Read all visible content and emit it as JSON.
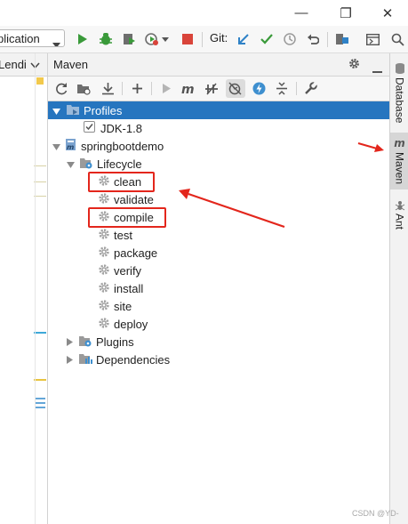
{
  "window": {
    "minimize_glyph": "—",
    "maximize_glyph": "❐",
    "close_glyph": "✕"
  },
  "toolbar": {
    "run_config_label": "plication",
    "git_label": "Git:",
    "icons": [
      "run-icon",
      "debug-icon",
      "coverage-icon",
      "profile-icon",
      "stop-icon",
      "git-update-icon",
      "git-commit-icon",
      "history-icon",
      "rollback-icon",
      "project-structure-icon",
      "terminal-icon",
      "search-icon"
    ]
  },
  "left_panel": {
    "header_label": "Lendi"
  },
  "maven": {
    "title": "Maven",
    "tree": {
      "profiles": {
        "label": "Profiles",
        "items": [
          {
            "label": "JDK-1.8"
          }
        ]
      },
      "project": {
        "label": "springbootdemo",
        "lifecycle": {
          "label": "Lifecycle",
          "goals": [
            {
              "label": "clean"
            },
            {
              "label": "validate"
            },
            {
              "label": "compile"
            },
            {
              "label": "test"
            },
            {
              "label": "package"
            },
            {
              "label": "verify"
            },
            {
              "label": "install"
            },
            {
              "label": "site"
            },
            {
              "label": "deploy"
            }
          ]
        },
        "plugins": {
          "label": "Plugins"
        },
        "dependencies": {
          "label": "Dependencies"
        }
      }
    }
  },
  "right_stripe": {
    "tabs": [
      {
        "label": "Database"
      },
      {
        "label": "Maven",
        "icon_text": "m",
        "active": true
      },
      {
        "label": "Ant"
      }
    ]
  },
  "watermark": "CSDN @YD-",
  "colors": {
    "selection": "#2675bf",
    "annotation_red": "#e3261c",
    "run_green": "#3a9a3a",
    "stop_red": "#d9443a",
    "git_blue": "#2f82c7"
  }
}
